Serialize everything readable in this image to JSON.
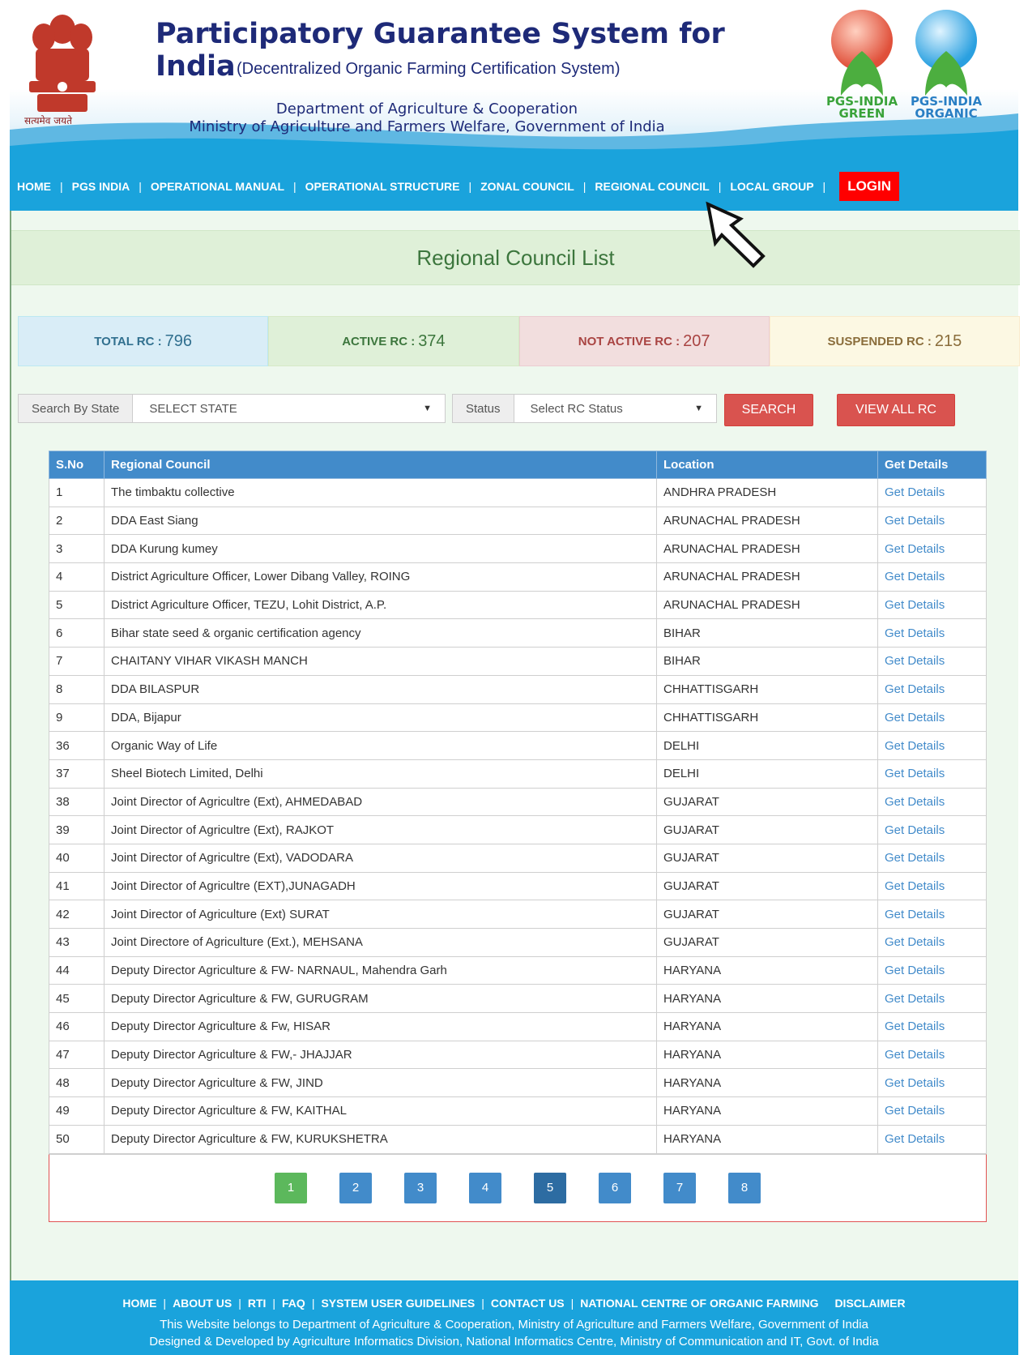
{
  "header": {
    "title": "Participatory Guarantee System for India",
    "subtitle": "(Decentralized Organic Farming Certification System)",
    "dept_line1": "Department of Agriculture & Cooperation",
    "dept_line2": "Ministry of Agriculture and Farmers Welfare, Government of India",
    "emblem_caption": "सत्यमेव जयते",
    "logo_green": "PGS-INDIA GREEN",
    "logo_organic": "PGS-INDIA ORGANIC"
  },
  "nav": {
    "items": [
      "HOME",
      "PGS INDIA",
      "OPERATIONAL MANUAL",
      "OPERATIONAL STRUCTURE",
      "ZONAL COUNCIL",
      "REGIONAL COUNCIL",
      "LOCAL GROUP"
    ],
    "login": "LOGIN"
  },
  "page": {
    "heading": "Regional Council List"
  },
  "stats": {
    "total_label": "TOTAL RC :",
    "total": "796",
    "active_label": "ACTIVE RC :",
    "active": "374",
    "notactive_label": "NOT ACTIVE RC :",
    "notactive": "207",
    "suspended_label": "SUSPENDED RC :",
    "suspended": "215"
  },
  "filters": {
    "state_label": "Search By State",
    "state_value": "SELECT STATE",
    "status_label": "Status",
    "status_value": "Select RC Status",
    "search_button": "SEARCH",
    "viewall_button": "VIEW ALL RC"
  },
  "table": {
    "headers": [
      "S.No",
      "Regional Council",
      "Location",
      "Get Details"
    ],
    "rows": [
      [
        "1",
        "The timbaktu collective",
        "ANDHRA PRADESH",
        "Get Details"
      ],
      [
        "2",
        "DDA East Siang",
        "ARUNACHAL PRADESH",
        "Get Details"
      ],
      [
        "3",
        "DDA Kurung kumey",
        "ARUNACHAL PRADESH",
        "Get Details"
      ],
      [
        "4",
        "District Agriculture Officer, Lower Dibang Valley, ROING",
        "ARUNACHAL PRADESH",
        "Get Details"
      ],
      [
        "5",
        "District Agriculture Officer, TEZU, Lohit District, A.P.",
        "ARUNACHAL PRADESH",
        "Get Details"
      ],
      [
        "6",
        "Bihar state seed & organic certification agency",
        "BIHAR",
        "Get Details"
      ],
      [
        "7",
        "CHAITANY VIHAR VIKASH MANCH",
        "BIHAR",
        "Get Details"
      ],
      [
        "8",
        "DDA BILASPUR",
        "CHHATTISGARH",
        "Get Details"
      ],
      [
        "9",
        "DDA, Bijapur",
        "CHHATTISGARH",
        "Get Details"
      ],
      [
        "36",
        "Organic Way of Life",
        "DELHI",
        "Get Details"
      ],
      [
        "37",
        "Sheel Biotech Limited, Delhi",
        "DELHI",
        "Get Details"
      ],
      [
        "38",
        "Joint Director of Agricultre (Ext), AHMEDABAD",
        "GUJARAT",
        "Get Details"
      ],
      [
        "39",
        "Joint Director of Agricultre (Ext), RAJKOT",
        "GUJARAT",
        "Get Details"
      ],
      [
        "40",
        "Joint Director of Agricultre (Ext), VADODARA",
        "GUJARAT",
        "Get Details"
      ],
      [
        "41",
        "Joint Director of Agricultre (EXT),JUNAGADH",
        "GUJARAT",
        "Get Details"
      ],
      [
        "42",
        "Joint Director of Agriculture (Ext) SURAT",
        "GUJARAT",
        "Get Details"
      ],
      [
        "43",
        "Joint Directore of Agriculture (Ext.), MEHSANA",
        "GUJARAT",
        "Get Details"
      ],
      [
        "44",
        "Deputy Director Agriculture & FW- NARNAUL, Mahendra Garh",
        "HARYANA",
        "Get Details"
      ],
      [
        "45",
        "Deputy Director Agriculture & FW, GURUGRAM",
        "HARYANA",
        "Get Details"
      ],
      [
        "46",
        "Deputy Director Agriculture & Fw, HISAR",
        "HARYANA",
        "Get Details"
      ],
      [
        "47",
        "Deputy Director Agriculture & FW,- JHAJJAR",
        "HARYANA",
        "Get Details"
      ],
      [
        "48",
        "Deputy Director Agriculture & FW, JIND",
        "HARYANA",
        "Get Details"
      ],
      [
        "49",
        "Deputy Director Agriculture & FW, KAITHAL",
        "HARYANA",
        "Get Details"
      ],
      [
        "50",
        "Deputy Director Agriculture & FW, KURUKSHETRA",
        "HARYANA",
        "Get Details"
      ]
    ]
  },
  "pagination": {
    "pages": [
      "1",
      "2",
      "3",
      "4",
      "5",
      "6",
      "7",
      "8"
    ],
    "current": "1"
  },
  "footer": {
    "links": [
      "HOME",
      "ABOUT US",
      "RTI",
      "FAQ",
      "SYSTEM USER GUIDELINES",
      "CONTACT US",
      "NATIONAL CENTRE OF ORGANIC FARMING",
      "DISCLAIMER"
    ],
    "line1": "This Website belongs to Department of Agriculture & Cooperation, Ministry of Agriculture and Farmers Welfare, Government of India",
    "line2": "Designed & Developed by Agriculture Informatics Division, National Informatics Centre, Ministry of Communication and IT, Govt. of India"
  },
  "colors": {
    "nav": "#1aa3dc",
    "login": "#ff0000",
    "table_header": "#428bca",
    "content_bg": "#eef8ee"
  }
}
